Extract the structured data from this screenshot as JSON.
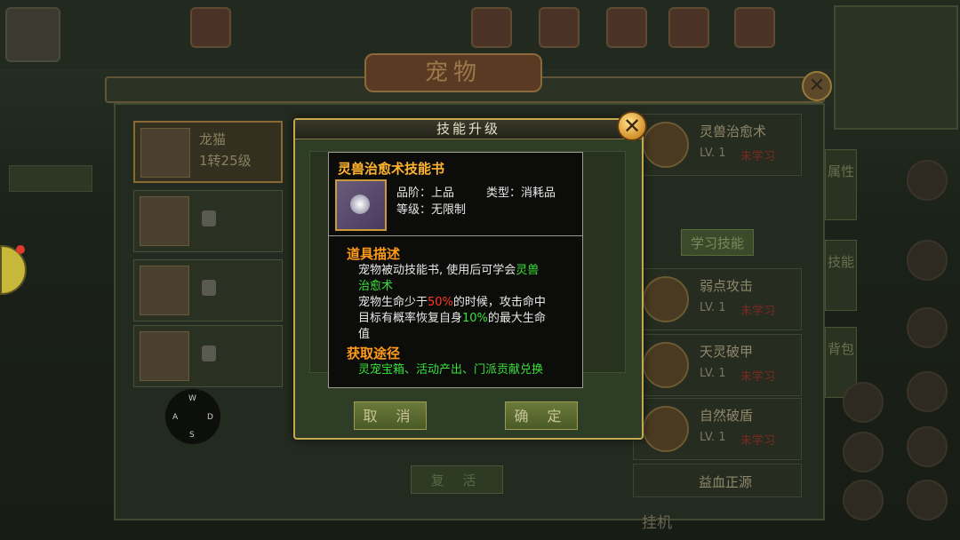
{
  "background": {
    "panel_title": "宠物",
    "pets": [
      {
        "name": "龙猫",
        "level": "1转25级",
        "selected": true,
        "locked": false
      },
      {
        "name": "",
        "level": "",
        "selected": false,
        "locked": true
      },
      {
        "name": "",
        "level": "",
        "selected": false,
        "locked": true
      },
      {
        "name": "",
        "level": "",
        "selected": false,
        "locked": true
      }
    ],
    "skills": [
      {
        "name": "灵兽治愈术",
        "level": "LV. 1",
        "status": "未学习"
      },
      {
        "name": "弱点攻击",
        "level": "LV. 1",
        "status": "未学习"
      },
      {
        "name": "天灵破甲",
        "level": "LV. 1",
        "status": "未学习"
      },
      {
        "name": "自然破盾",
        "level": "LV. 1",
        "status": "未学习"
      },
      {
        "name": "益血正源",
        "level": "",
        "status": ""
      }
    ],
    "learn_button": "学习技能",
    "side_tabs": [
      "属性",
      "技能",
      "背包"
    ],
    "revive_button": "复 活",
    "idle_label": "挂机",
    "joystick": {
      "w": "W",
      "a": "A",
      "s": "S",
      "d": "D"
    }
  },
  "dialog": {
    "title": "技能升级",
    "cancel": "取 消",
    "confirm": "确 定"
  },
  "tooltip": {
    "item_name": "灵兽治愈术技能书",
    "grade_label": "品阶：",
    "grade_value": "上品",
    "type_label": "类型：",
    "type_value": "消耗品",
    "level_label": "等级：",
    "level_value": "无限制",
    "desc_title": "道具描述",
    "desc_line1_a": "宠物被动技能书, 使用后可学会",
    "desc_line1_b": "灵兽",
    "desc_line2": "治愈术",
    "desc_line3_a": "宠物生命少于",
    "desc_line3_b": "50%",
    "desc_line3_c": "的时候，攻击命中",
    "desc_line4_a": "目标有概率恢复自身",
    "desc_line4_b": "10%",
    "desc_line4_c": "的最大生命",
    "desc_line5": "值",
    "source_title": "获取途径",
    "source_text": "灵宠宝箱、活动产出、门派贡献兑换"
  },
  "colors": {
    "accent_gold": "#c8a84e",
    "item_name": "#ffb42e",
    "section_title": "#ff9a1a",
    "highlight_green": "#3ae03a",
    "highlight_red": "#ff3a2a"
  }
}
